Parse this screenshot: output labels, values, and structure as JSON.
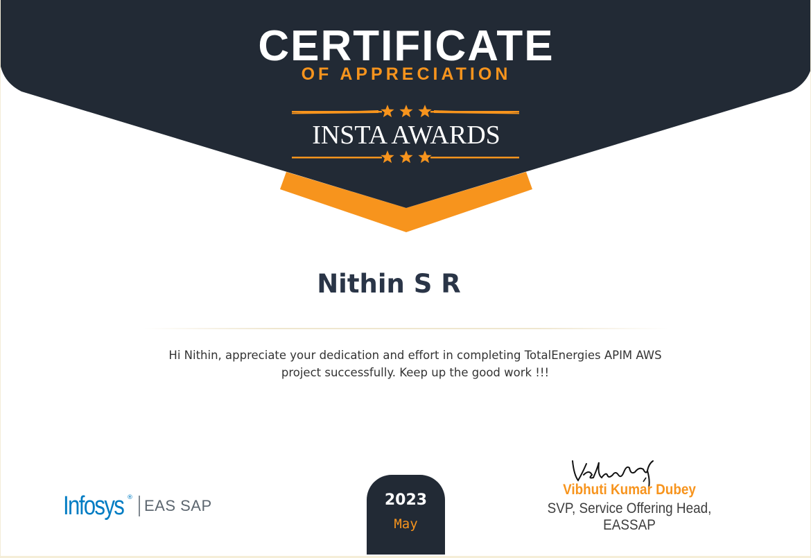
{
  "certificate": {
    "title": "CERTIFICATE",
    "subtitle": "OF APPRECIATION",
    "award_name": "INSTA AWARDS"
  },
  "recipient": {
    "name": "Nithin S R"
  },
  "message": "Hi Nithin, appreciate your dedication and effort in completing TotalEnergies APIM AWS project successfully. Keep up the good work !!!",
  "date": {
    "year": "2023",
    "month": "May"
  },
  "logo": {
    "brand": "Infosys",
    "registered_mark": "®",
    "unit": "EAS SAP"
  },
  "signatory": {
    "name": "Vibhuti Kumar Dubey",
    "title": "SVP, Service Offering Head, EASSAP"
  },
  "colors": {
    "banner": "#222a35",
    "accent": "#f7941d",
    "name_text": "#2a3547",
    "logo_blue": "#007cc3"
  },
  "icons": [
    "star-icon"
  ]
}
